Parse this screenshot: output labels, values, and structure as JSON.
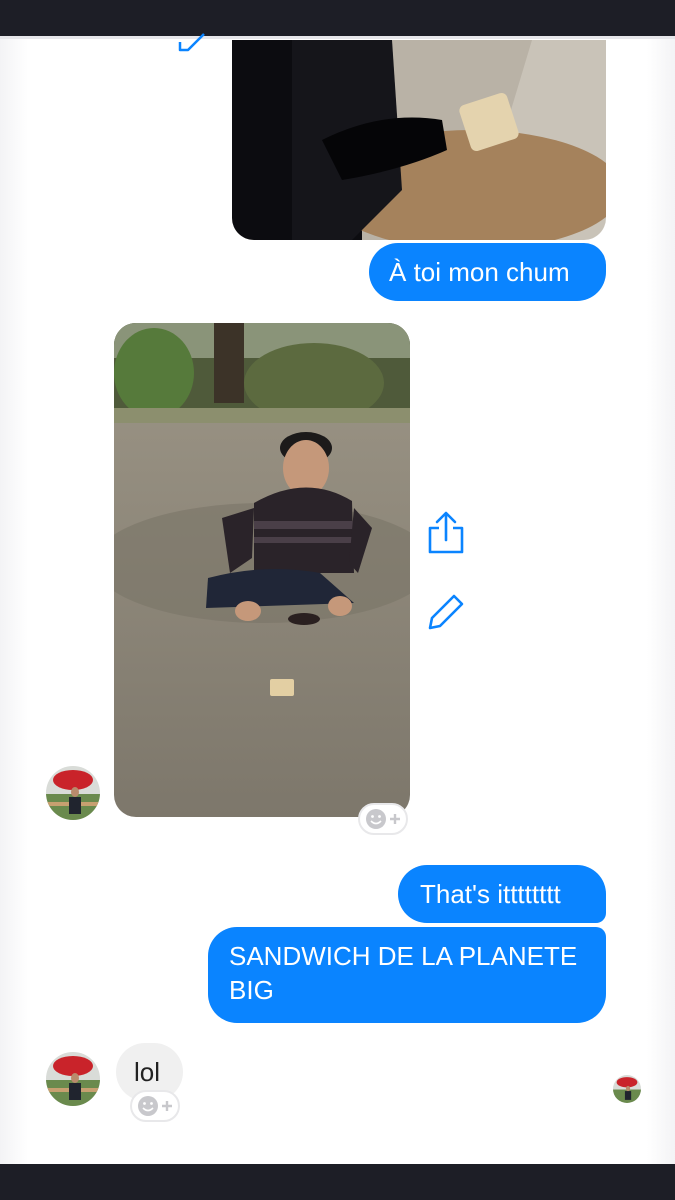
{
  "app": "Messenger",
  "messages": {
    "outgoing_1": "À toi mon chum",
    "outgoing_2": "That's itttttttt",
    "outgoing_3": "SANDWICH DE LA PLANETE BIG",
    "incoming_1": "lol"
  },
  "images": {
    "sent_photo": "photo of shoe stepping near bread slice on floor",
    "received_photo": "man crouching outdoors next to bread slice on ground"
  },
  "icons": [
    "edit-icon",
    "share-icon",
    "add-reaction-icon"
  ],
  "colors": {
    "outgoing_bubble": "#0a84ff",
    "incoming_bubble": "#f0f0f0",
    "accent": "#0a84ff"
  }
}
